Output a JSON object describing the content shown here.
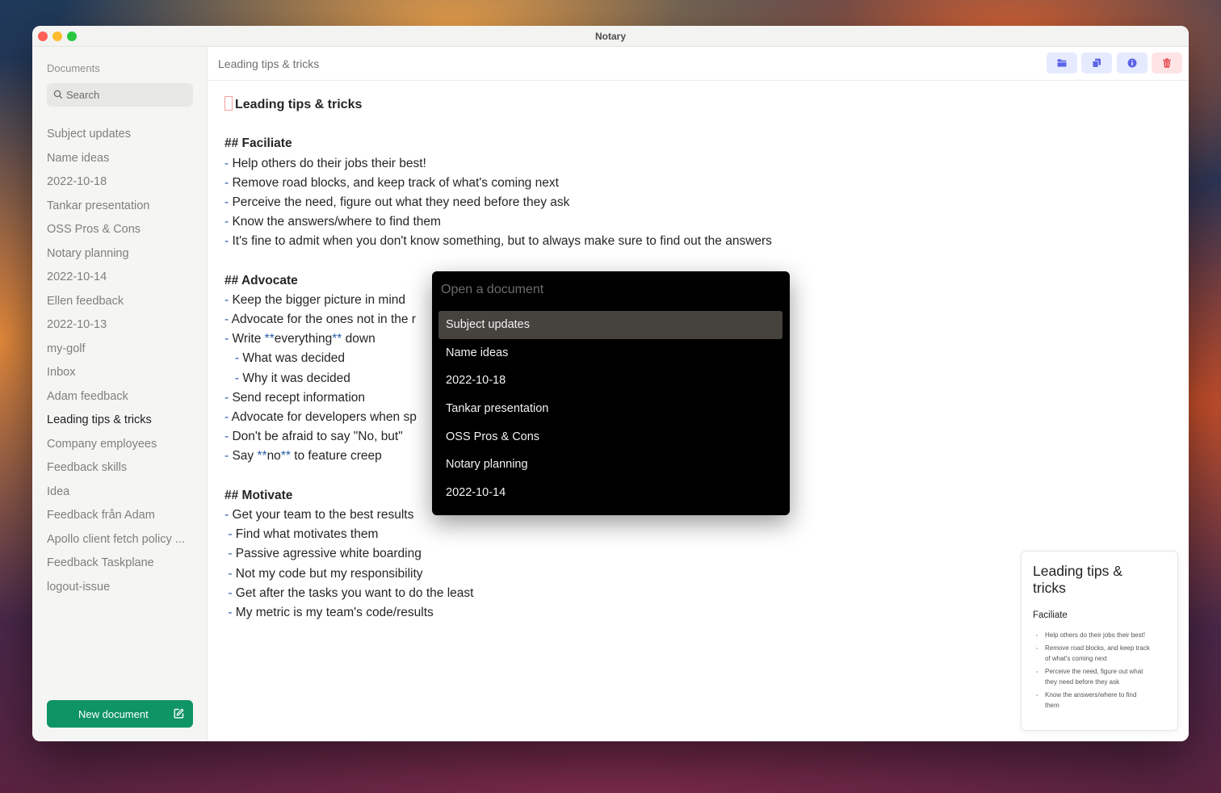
{
  "window": {
    "title": "Notary"
  },
  "sidebar": {
    "heading": "Documents",
    "search_placeholder": "Search",
    "items": [
      "Subject updates",
      "Name ideas",
      "2022-10-18",
      "Tankar presentation",
      "OSS Pros & Cons",
      "Notary planning",
      "2022-10-14",
      "Ellen feedback",
      "2022-10-13",
      "my-golf",
      "Inbox",
      "Adam feedback",
      "Leading tips & tricks",
      "Company employees",
      "Feedback skills",
      "Idea",
      "Feedback från Adam",
      "Apollo client fetch policy ...",
      "Feedback Taskplane",
      "logout-issue"
    ],
    "active_item": "Leading tips & tricks",
    "new_document_label": "New document"
  },
  "header": {
    "document_title": "Leading tips & tricks",
    "toolbar": {
      "folder_icon": "folder-icon",
      "copy_icon": "copy-icon",
      "info_icon": "info-icon",
      "delete_icon": "trash-icon",
      "accent": "#5b63e6",
      "danger": "#e5484d"
    }
  },
  "editor": {
    "lines": [
      {
        "type": "h1",
        "text": "Leading tips & tricks"
      },
      {
        "type": "blank",
        "text": ""
      },
      {
        "type": "h2",
        "text": "## Faciliate"
      },
      {
        "type": "li",
        "indent": "",
        "text": "Help others do their jobs their best!"
      },
      {
        "type": "li",
        "indent": "",
        "text": "Remove road blocks, and keep track of what's coming next"
      },
      {
        "type": "li",
        "indent": "",
        "text": "Perceive the need, figure out what they need before they ask"
      },
      {
        "type": "li",
        "indent": "",
        "text": "Know the answers/where to find them"
      },
      {
        "type": "li",
        "indent": "",
        "text": "It's fine to admit when you don't know something, but to always make sure to find out the answers"
      },
      {
        "type": "blank",
        "text": ""
      },
      {
        "type": "h2",
        "text": "## Advocate"
      },
      {
        "type": "li",
        "indent": "",
        "text": "Keep the bigger picture in mind"
      },
      {
        "type": "li",
        "indent": "",
        "text": "Advocate for the ones not in the r"
      },
      {
        "type": "li",
        "indent": "",
        "pre": "Write ",
        "bold_marker_open": "**",
        "bold": "everything",
        "bold_marker_close": "**",
        "post": " down"
      },
      {
        "type": "li",
        "indent": "   ",
        "text": "What was decided"
      },
      {
        "type": "li",
        "indent": "   ",
        "text": "Why it was decided"
      },
      {
        "type": "li",
        "indent": "",
        "text": "Send recept information"
      },
      {
        "type": "li",
        "indent": "",
        "text": "Advocate for developers when sp"
      },
      {
        "type": "li",
        "indent": "",
        "text": "Don't be afraid to say \"No, but\""
      },
      {
        "type": "li",
        "indent": "",
        "pre": "Say ",
        "bold_marker_open": "**",
        "bold": "no",
        "bold_marker_close": "**",
        "post": " to feature creep"
      },
      {
        "type": "blank",
        "text": ""
      },
      {
        "type": "h2",
        "text": "## Motivate"
      },
      {
        "type": "li",
        "indent": "",
        "text": "Get your team to the best results"
      },
      {
        "type": "li",
        "indent": " ",
        "text": "Find what motivates them"
      },
      {
        "type": "li",
        "indent": " ",
        "text": "Passive agressive white boarding"
      },
      {
        "type": "li",
        "indent": " ",
        "text": "Not my code but my responsibility"
      },
      {
        "type": "li",
        "indent": " ",
        "text": "Get after the tasks you want to do the least"
      },
      {
        "type": "li",
        "indent": " ",
        "text": "My metric is my team's code/results"
      }
    ]
  },
  "palette": {
    "placeholder": "Open a document",
    "items": [
      "Subject updates",
      "Name ideas",
      "2022-10-18",
      "Tankar presentation",
      "OSS Pros & Cons",
      "Notary planning",
      "2022-10-14"
    ],
    "selected_index": 0
  },
  "preview": {
    "title": "Leading tips & tricks",
    "section": "Faciliate",
    "bullets": [
      "Help others do their jobs their best!",
      "Remove road blocks, and keep track of what's coming next",
      "Perceive the need, figure out what they need before they ask",
      "Know the answers/where to find them"
    ]
  }
}
